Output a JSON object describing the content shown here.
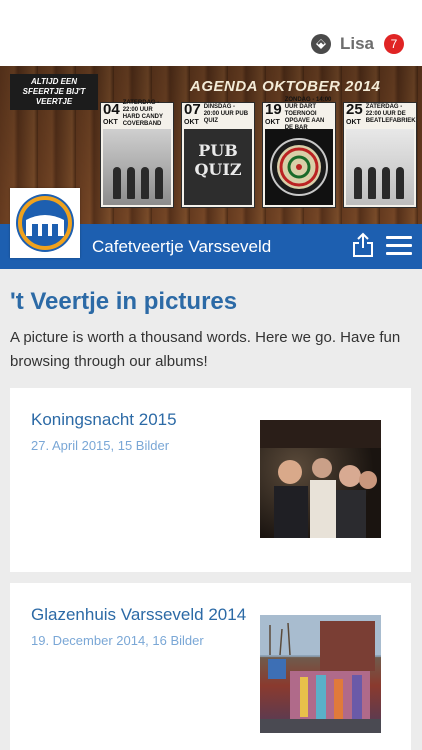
{
  "topbar": {
    "user_name": "Lisa",
    "badge_count": "7"
  },
  "banner": {
    "slogan": "ALTIJD EEN SFEERTJE BIJ'T VEERTJE",
    "agenda_title": "AGENDA OKTOBER 2014",
    "events": [
      {
        "day": "04",
        "month": "OKT",
        "text": "ZATERDAG - 22:00 UUR HARD CANDY COVERBAND",
        "picture": "band"
      },
      {
        "day": "07",
        "month": "OKT",
        "text": "DINSDAG - 20:00 UUR PUB QUIZ",
        "picture": "PUB QUIZ"
      },
      {
        "day": "19",
        "month": "OKT",
        "text": "ZONDAG - 14:00 UUR DART TOERNOOI OPGAVE AAN DE BAR",
        "picture": "dartboard"
      },
      {
        "day": "25",
        "month": "OKT",
        "text": "ZATERDAG - 22:00 UUR DE BEATLEFABRIEK",
        "picture": "band"
      }
    ]
  },
  "navbar": {
    "title": "Cafetveertje Varsseveld",
    "share_icon": "share-icon",
    "menu_icon": "hamburger-icon"
  },
  "page": {
    "heading": "'t Veertje in pictures",
    "intro": "A picture is worth a thousand words. Here we go. Have fun browsing through our albums!"
  },
  "albums": [
    {
      "title": "Koningsnacht 2015",
      "meta": "27. April 2015, 15 Bilder"
    },
    {
      "title": "Glazenhuis Varsseveld 2014",
      "meta": "19. December 2014, 16 Bilder"
    }
  ],
  "colors": {
    "nav_blue": "#1d5fb0",
    "title_blue": "#2c6aa6",
    "meta_blue": "#7aa7d6",
    "badge_red": "#e02424"
  }
}
